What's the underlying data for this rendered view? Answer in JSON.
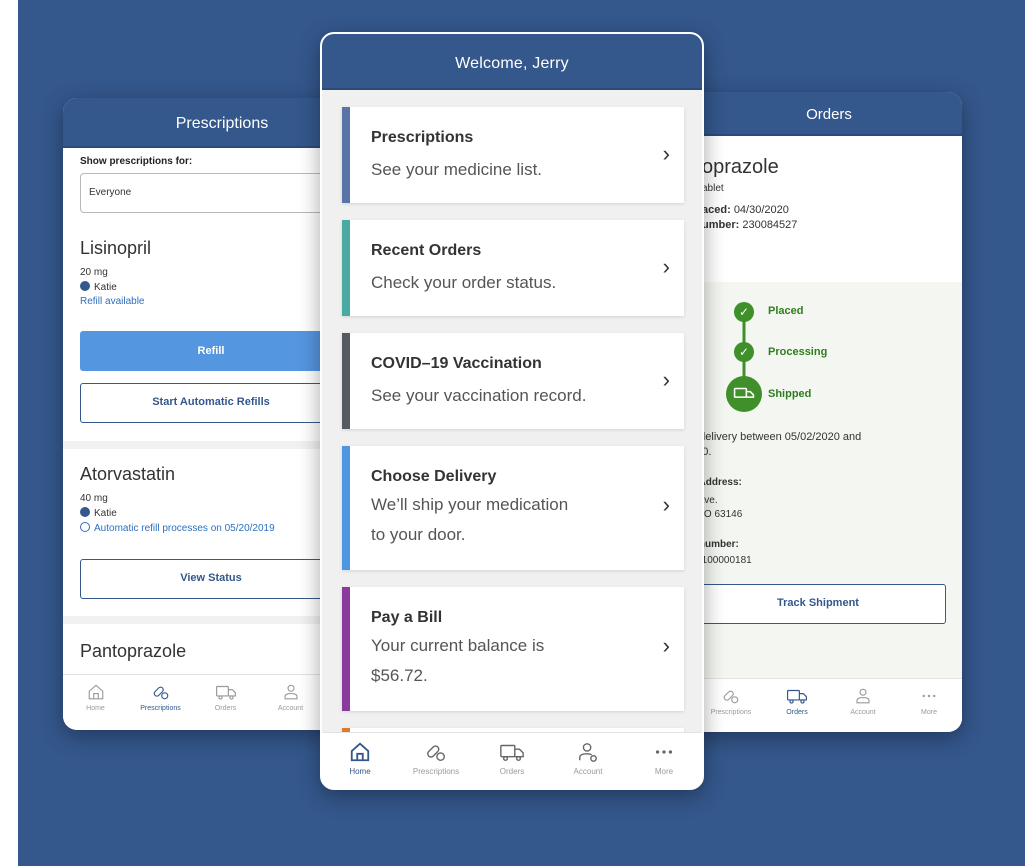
{
  "colors": {
    "background": "#34578c",
    "header": "#34578c",
    "accent_blue": "#5596e0",
    "success_green": "#3f8f2a"
  },
  "left": {
    "title": "Prescriptions",
    "filter_label": "Show prescriptions for:",
    "filter_value": "Everyone",
    "drug1": {
      "name": "Lisinopril",
      "dose": "20 mg",
      "person": "Katie",
      "status": "Refill available",
      "primary_btn": "Refill",
      "secondary_btn": "Start Automatic Refills"
    },
    "drug2": {
      "name": "Atorvastatin",
      "dose": "40 mg",
      "person": "Katie",
      "status": "Automatic refill processes on 05/20/2019",
      "btn": "View Status"
    },
    "drug3": {
      "name": "Pantoprazole"
    },
    "nav": [
      {
        "label": "Home",
        "icon": "home-icon"
      },
      {
        "label": "Prescriptions",
        "icon": "pill-icon"
      },
      {
        "label": "Orders",
        "icon": "truck-icon"
      },
      {
        "label": "Account",
        "icon": "account-icon"
      }
    ]
  },
  "center": {
    "title": "Welcome, Jerry",
    "cards": [
      {
        "title": "Prescriptions",
        "sub1": "See your medicine list.",
        "sub2": "",
        "color": "#5b74a8"
      },
      {
        "title": "Recent Orders",
        "sub1": "Check your order status.",
        "sub2": "",
        "color": "#4aa9a0"
      },
      {
        "title": "COVID–19 Vaccination",
        "sub1": "See your vaccination record.",
        "sub2": "",
        "color": "#555a60"
      },
      {
        "title": "Choose Delivery",
        "sub1": "We’ll ship your medication",
        "sub2": "to your door.",
        "color": "#4c97e0"
      },
      {
        "title": "Pay a Bill",
        "sub1": "Your current balance is",
        "sub2": "$56.72.",
        "color": "#8a3a9a"
      }
    ],
    "nav": [
      {
        "label": "Home",
        "icon": "home-icon"
      },
      {
        "label": "Prescriptions",
        "icon": "pill-icon"
      },
      {
        "label": "Orders",
        "icon": "truck-icon"
      },
      {
        "label": "Account",
        "icon": "account-settings-icon"
      },
      {
        "label": "More",
        "icon": "more-icon"
      }
    ]
  },
  "right": {
    "title": "Orders",
    "drug": "oprazole",
    "form": "ablet",
    "placed_label": "aced:",
    "placed_value": "04/30/2020",
    "number_label": "umber:",
    "number_value": "230084527",
    "steps": [
      "Placed",
      "Processing",
      "Shipped"
    ],
    "delivery_line1": "d delivery between 05/02/2020 and",
    "delivery_line2": "020.",
    "address_label": "g Address:",
    "address_line1": "e Ave.",
    "address_line2": ", MO 63146",
    "tracking_label": "g number:",
    "tracking_value": "F0100000181",
    "track_btn": "Track Shipment",
    "nav": [
      {
        "label": "Prescriptions",
        "icon": "pill-icon"
      },
      {
        "label": "Orders",
        "icon": "truck-icon"
      },
      {
        "label": "Account",
        "icon": "account-icon"
      },
      {
        "label": "More",
        "icon": "more-icon"
      }
    ]
  }
}
